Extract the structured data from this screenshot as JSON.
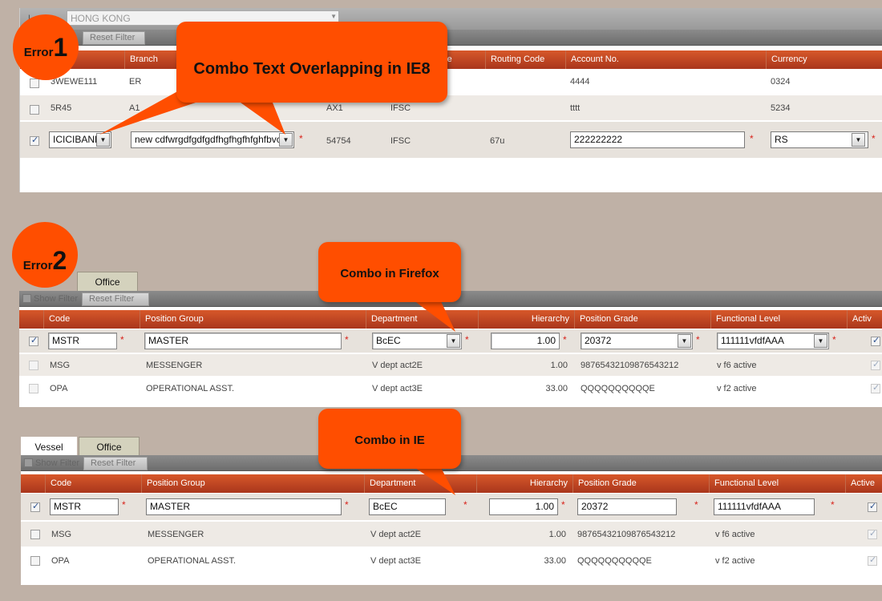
{
  "error1": {
    "badge": {
      "word": "Error",
      "number": "1"
    },
    "callout": "Combo Text Overlapping in IE8",
    "location_label_partial": "L",
    "location_value": "HONG KONG",
    "reset_filter": "Reset Filter",
    "columns": [
      "Branch",
      "ype",
      "Routing Code",
      "Account No.",
      "Currency"
    ],
    "rows": [
      {
        "code": "3WEWE111",
        "branch": "ER",
        "routing": "",
        "account": "4444",
        "currency": "0324"
      },
      {
        "code": "5R45",
        "branch": "A1",
        "type_code": "AX1",
        "type": "IFSC",
        "routing": "",
        "account": "tttt",
        "currency": "5234"
      }
    ],
    "edit_row": {
      "bank": "ICICIBANK",
      "branch": "new cdfwrgdfgdfgdfhgfhgfhfghfbvc",
      "type_code": "54754",
      "type": "IFSC",
      "routing": "67u",
      "account": "222222222",
      "currency": "RS"
    }
  },
  "error2": {
    "badge": {
      "word": "Error",
      "number": "2"
    },
    "callout": "Combo in Firefox",
    "tab_office": "Office",
    "show_filter": "Show Filter",
    "reset_filter": "Reset Filter",
    "columns": [
      "Code",
      "Position Group",
      "Department",
      "Hierarchy",
      "Position Grade",
      "Functional Level",
      "Activ"
    ],
    "edit_row": {
      "code": "MSTR",
      "group": "MASTER",
      "dept": "BcEC",
      "hierarchy": "1.00",
      "grade": "20372",
      "level": "111111vfdfAAA"
    },
    "rows": [
      {
        "code": "MSG",
        "group": "MESSENGER",
        "dept": "V dept act2E",
        "hierarchy": "1.00",
        "grade": "98765432109876543212",
        "level": "v f6 active"
      },
      {
        "code": "OPA",
        "group": "OPERATIONAL ASST.",
        "dept": "V dept  act3E",
        "hierarchy": "33.00",
        "grade": "QQQQQQQQQQE",
        "level": "v f2 active"
      }
    ]
  },
  "ie": {
    "callout": "Combo in IE",
    "tab_vessel": "Vessel",
    "tab_office": "Office",
    "show_filter": "Show Filter",
    "reset_filter": "Reset Filter",
    "columns": [
      "Code",
      "Position Group",
      "Department",
      "Hierarchy",
      "Position Grade",
      "Functional Level",
      "Active"
    ],
    "edit_row": {
      "code": "MSTR",
      "group": "MASTER",
      "dept": "BcEC",
      "hierarchy": "1.00",
      "grade": "20372",
      "level": "111111vfdfAAA"
    },
    "rows": [
      {
        "code": "MSG",
        "group": "MESSENGER",
        "dept": "V dept act2E",
        "hierarchy": "1.00",
        "grade": "98765432109876543212",
        "level": "v f6 active"
      },
      {
        "code": "OPA",
        "group": "OPERATIONAL ASST.",
        "dept": "V dept  act3E",
        "hierarchy": "33.00",
        "grade": "QQQQQQQQQQE",
        "level": "v f2 active"
      }
    ]
  },
  "colors": {
    "accent": "#ff4e00",
    "header": "#c2471f",
    "backdrop": "#bfb1a6"
  }
}
